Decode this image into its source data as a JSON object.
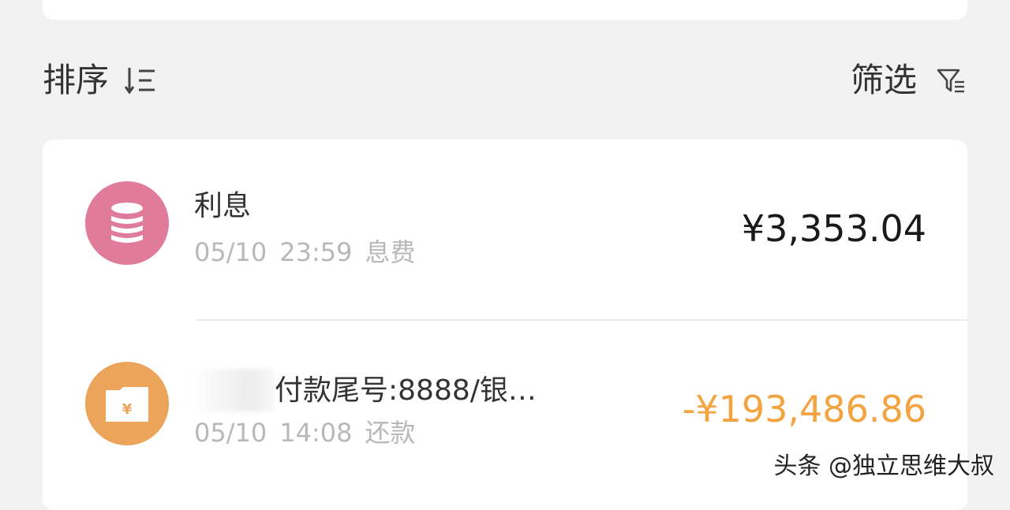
{
  "toolbar": {
    "sort_label": "排序",
    "filter_label": "筛选",
    "sort_icon": "sort-descending-icon",
    "filter_icon": "filter-funnel-icon"
  },
  "transactions": [
    {
      "icon": "coins-stack-icon",
      "icon_color": "#e07b9c",
      "title": "利息",
      "date": "05/10",
      "time": "23:59",
      "category": "息费",
      "amount": "¥3,353.04",
      "amount_color": "#1a1a1a"
    },
    {
      "icon": "yuan-folder-icon",
      "icon_color": "#eba45a",
      "title": "付款尾号:8888/银…",
      "date": "05/10",
      "time": "14:08",
      "category": "还款",
      "amount": "-¥193,486.86",
      "amount_color": "#f3a33f"
    }
  ],
  "watermark": "头条 @独立思维大叔"
}
